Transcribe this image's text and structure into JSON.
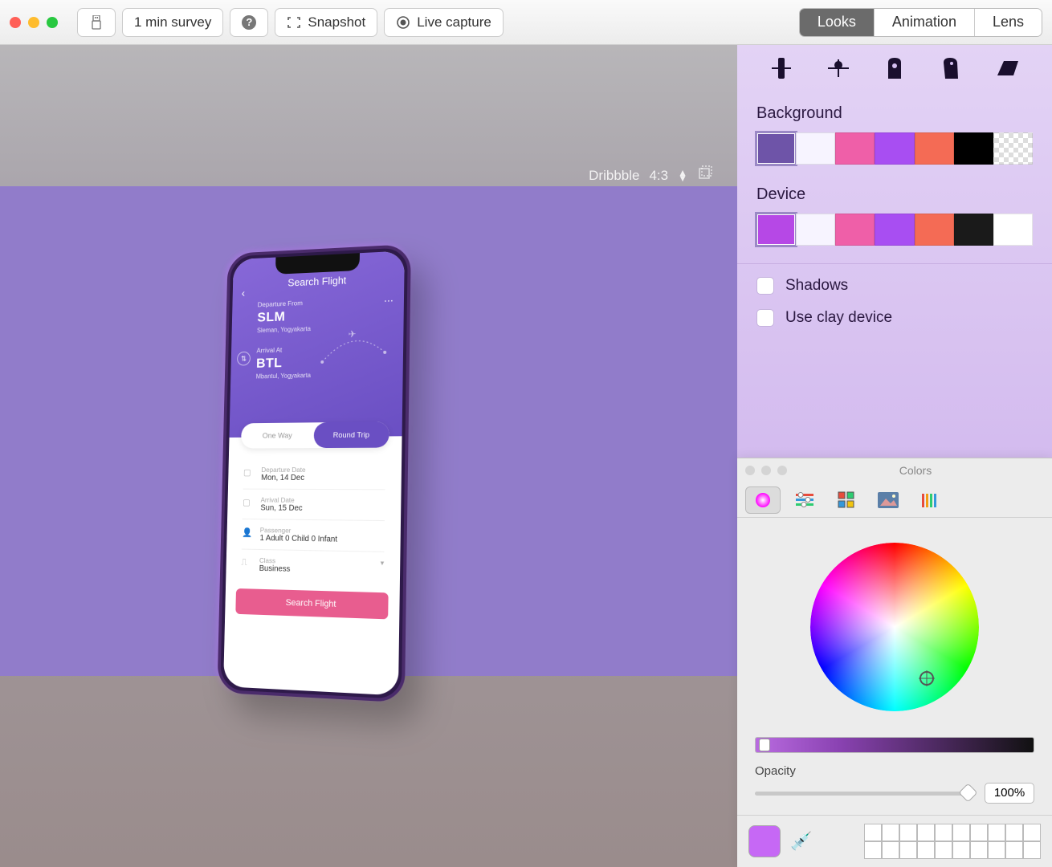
{
  "toolbar": {
    "survey": "1 min survey",
    "help": "?",
    "snapshot": "Snapshot",
    "live_capture": "Live capture",
    "tabs": {
      "looks": "Looks",
      "animation": "Animation",
      "lens": "Lens"
    }
  },
  "canvas": {
    "label": "Dribbble",
    "ratio": "4:3"
  },
  "phone": {
    "title": "Search Flight",
    "from_label": "Departure From",
    "from_code": "SLM",
    "from_city": "Sleman, Yogyakarta",
    "to_label": "Arrival At",
    "to_code": "BTL",
    "to_city": "Mbantul, Yogyakarta",
    "oneway": "One Way",
    "roundtrip": "Round Trip",
    "dep_label": "Departure Date",
    "dep_val": "Mon, 14 Dec",
    "arr_label": "Arrival Date",
    "arr_val": "Sun, 15 Dec",
    "pax_label": "Passenger",
    "pax_val": "1 Adult   0 Child   0 Infant",
    "class_label": "Class",
    "class_val": "Business",
    "search_btn": "Search Flight"
  },
  "side": {
    "background": "Background",
    "device": "Device",
    "bg_colors": [
      "#6e54a8",
      "#f7f4ff",
      "#ef5fa8",
      "#a84ef2",
      "#f46b55",
      "#000000",
      "checker"
    ],
    "dev_colors": [
      "#b648e6",
      "#f7f4ff",
      "#ef5fa8",
      "#a84ef2",
      "#f46b55",
      "#1a1a1a",
      "#ffffff"
    ],
    "shadows": "Shadows",
    "clay": "Use clay device"
  },
  "colors": {
    "title": "Colors",
    "opacity_label": "Opacity",
    "opacity_value": "100%",
    "current": "#c668f5"
  }
}
